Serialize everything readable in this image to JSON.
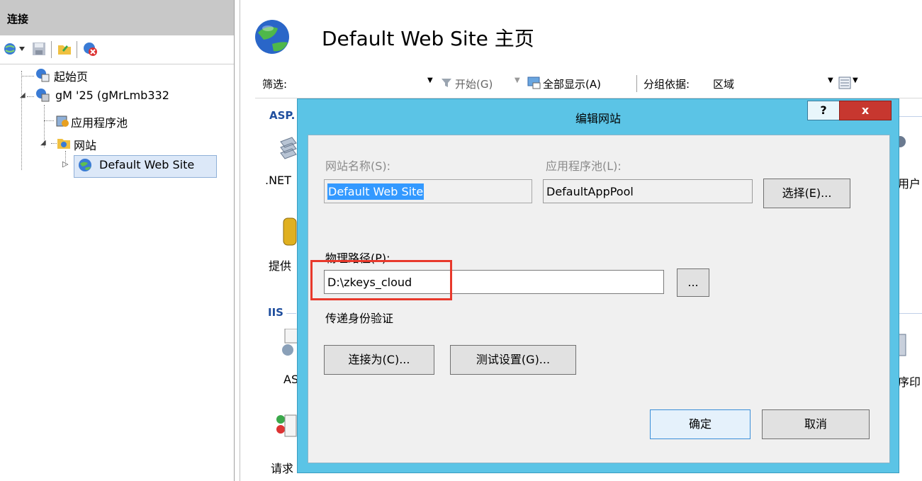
{
  "connections": {
    "title": "连接",
    "tree": {
      "start_page": "起始页",
      "server": "gM          '25 (gMrLmb332",
      "app_pools": "应用程序池",
      "sites": "网站",
      "default_site": "Default Web Site"
    }
  },
  "main": {
    "title": "Default Web Site 主页",
    "filter": {
      "label": "筛选:",
      "start": "开始(G)",
      "show_all": "全部显示(A)",
      "group_by_label": "分组依据:",
      "group_by_value": "区域"
    },
    "groups": {
      "asp": "ASP.",
      "iis": "IIS"
    },
    "features": {
      "net": ".NET",
      "provider": "提供",
      "asp": "AS",
      "request": "请求",
      "user_right": "用户",
      "program_right": "序印"
    }
  },
  "dialog": {
    "title": "编辑网站",
    "help": "?",
    "close": "x",
    "site_name_label": "网站名称(S):",
    "site_name_value": "Default Web Site",
    "app_pool_label": "应用程序池(L):",
    "app_pool_value": "DefaultAppPool",
    "select_button": "选择(E)...",
    "physical_path_label": "物理路径(P):",
    "physical_path_value": "D:\\zkeys_cloud",
    "browse_button": "...",
    "pass_through_label": "传递身份验证",
    "connect_as_button": "连接为(C)...",
    "test_settings_button": "测试设置(G)...",
    "ok_button": "确定",
    "cancel_button": "取消"
  },
  "colors": {
    "dialog_frame": "#5bc4e6",
    "close_button": "#c7372f",
    "highlight": "#e8392c",
    "selection": "#3399ff"
  }
}
